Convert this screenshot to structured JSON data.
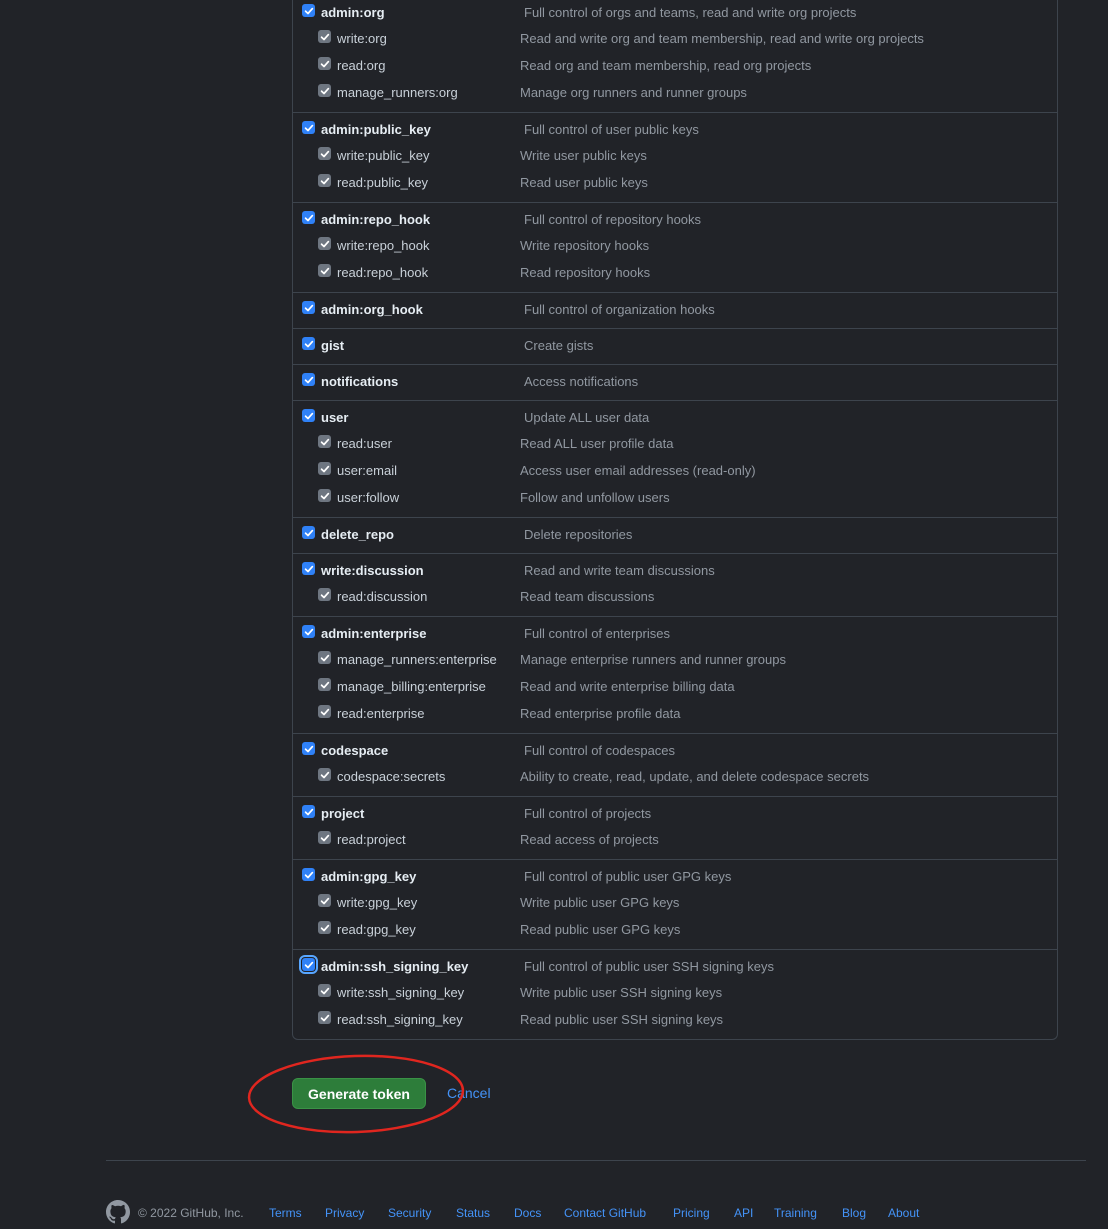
{
  "scope_groups": [
    {
      "parent": {
        "name": "admin:org",
        "desc": "Full control of orgs and teams, read and write org projects"
      },
      "children": [
        {
          "name": "write:org",
          "desc": "Read and write org and team membership, read and write org projects"
        },
        {
          "name": "read:org",
          "desc": "Read org and team membership, read org projects"
        },
        {
          "name": "manage_runners:org",
          "desc": "Manage org runners and runner groups"
        }
      ]
    },
    {
      "parent": {
        "name": "admin:public_key",
        "desc": "Full control of user public keys"
      },
      "children": [
        {
          "name": "write:public_key",
          "desc": "Write user public keys"
        },
        {
          "name": "read:public_key",
          "desc": "Read user public keys"
        }
      ]
    },
    {
      "parent": {
        "name": "admin:repo_hook",
        "desc": "Full control of repository hooks"
      },
      "children": [
        {
          "name": "write:repo_hook",
          "desc": "Write repository hooks"
        },
        {
          "name": "read:repo_hook",
          "desc": "Read repository hooks"
        }
      ]
    },
    {
      "parent": {
        "name": "admin:org_hook",
        "desc": "Full control of organization hooks"
      },
      "children": []
    },
    {
      "parent": {
        "name": "gist",
        "desc": "Create gists"
      },
      "children": []
    },
    {
      "parent": {
        "name": "notifications",
        "desc": "Access notifications"
      },
      "children": []
    },
    {
      "parent": {
        "name": "user",
        "desc": "Update ALL user data"
      },
      "children": [
        {
          "name": "read:user",
          "desc": "Read ALL user profile data"
        },
        {
          "name": "user:email",
          "desc": "Access user email addresses (read-only)"
        },
        {
          "name": "user:follow",
          "desc": "Follow and unfollow users"
        }
      ]
    },
    {
      "parent": {
        "name": "delete_repo",
        "desc": "Delete repositories"
      },
      "children": []
    },
    {
      "parent": {
        "name": "write:discussion",
        "desc": "Read and write team discussions"
      },
      "children": [
        {
          "name": "read:discussion",
          "desc": "Read team discussions"
        }
      ]
    },
    {
      "parent": {
        "name": "admin:enterprise",
        "desc": "Full control of enterprises"
      },
      "children": [
        {
          "name": "manage_runners:enterprise",
          "desc": "Manage enterprise runners and runner groups"
        },
        {
          "name": "manage_billing:enterprise",
          "desc": "Read and write enterprise billing data"
        },
        {
          "name": "read:enterprise",
          "desc": "Read enterprise profile data"
        }
      ]
    },
    {
      "parent": {
        "name": "codespace",
        "desc": "Full control of codespaces"
      },
      "children": [
        {
          "name": "codespace:secrets",
          "desc": "Ability to create, read, update, and delete codespace secrets"
        }
      ]
    },
    {
      "parent": {
        "name": "project",
        "desc": "Full control of projects"
      },
      "children": [
        {
          "name": "read:project",
          "desc": "Read access of projects"
        }
      ]
    },
    {
      "parent": {
        "name": "admin:gpg_key",
        "desc": "Full control of public user GPG keys"
      },
      "children": [
        {
          "name": "write:gpg_key",
          "desc": "Write public user GPG keys"
        },
        {
          "name": "read:gpg_key",
          "desc": "Read public user GPG keys"
        }
      ]
    },
    {
      "parent": {
        "name": "admin:ssh_signing_key",
        "desc": "Full control of public user SSH signing keys",
        "focused": true
      },
      "children": [
        {
          "name": "write:ssh_signing_key",
          "desc": "Write public user SSH signing keys"
        },
        {
          "name": "read:ssh_signing_key",
          "desc": "Read public user SSH signing keys"
        }
      ]
    }
  ],
  "actions": {
    "generate_label": "Generate token",
    "cancel_label": "Cancel"
  },
  "footer": {
    "copyright": "© 2022 GitHub, Inc.",
    "links": [
      "Terms",
      "Privacy",
      "Security",
      "Status",
      "Docs",
      "Contact GitHub",
      "Pricing",
      "API",
      "Training",
      "Blog",
      "About"
    ]
  },
  "colors": {
    "background": "#212328",
    "checkbox_checked": "#2f81f7",
    "checkbox_child": "#6e7681",
    "primary_button": "#2d7d3a",
    "link": "#4493f8",
    "annotation": "#e0261f"
  }
}
